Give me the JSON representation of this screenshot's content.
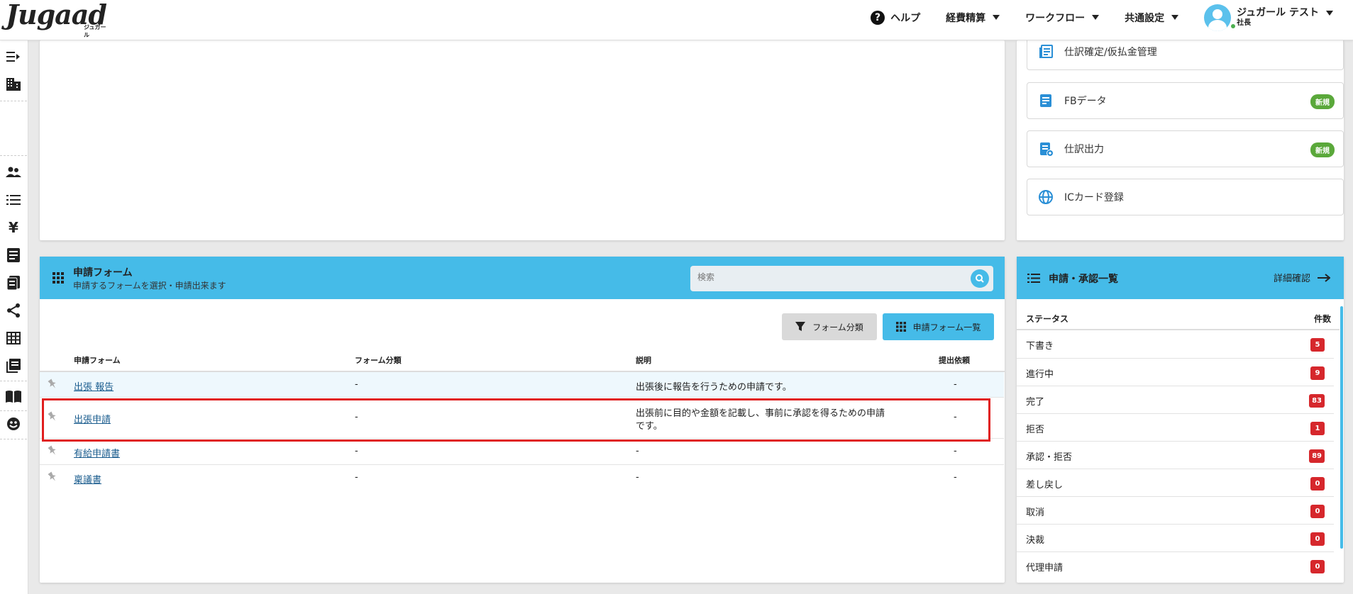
{
  "header": {
    "logo": "Jugaad",
    "logo_sub": "ジュガール",
    "nav": [
      {
        "label": "ヘルプ",
        "icon": "help-icon"
      },
      {
        "label": "経費精算"
      },
      {
        "label": "ワークフロー"
      },
      {
        "label": "共通設定"
      }
    ],
    "user": {
      "name": "ジュガール テスト",
      "role": "社長"
    }
  },
  "menu_cards": [
    {
      "label": "仕訳確定/仮払金管理",
      "icon": "journal-icon"
    },
    {
      "label": "FBデータ",
      "icon": "document-icon",
      "badge": "新規"
    },
    {
      "label": "仕訳出力",
      "icon": "export-icon",
      "badge": "新規"
    },
    {
      "label": "ICカード登録",
      "icon": "globe-icon"
    }
  ],
  "forms_panel": {
    "title": "申請フォーム",
    "subtitle": "申請するフォームを選択・申請出来ます",
    "search_placeholder": "検索",
    "btn_category": "フォーム分類",
    "btn_list": "申請フォーム一覧",
    "columns": [
      "申請フォーム",
      "フォーム分類",
      "説明",
      "提出依頼"
    ],
    "rows": [
      {
        "name": "出張 報告",
        "category": "-",
        "desc1": "出張後に報告を行うための申請です。",
        "desc2": "",
        "request": "-"
      },
      {
        "name": "出張申請",
        "category": "-",
        "desc1": "出張前に目的や金額を記載し、事前に承認を得るための申請",
        "desc2": "です。",
        "request": "-"
      },
      {
        "name": "有給申請書",
        "category": "-",
        "desc1": "-",
        "desc2": "",
        "request": "-"
      },
      {
        "name": "稟議書",
        "category": "-",
        "desc1": "-",
        "desc2": "",
        "request": "-"
      }
    ]
  },
  "approval_panel": {
    "title": "申請・承認一覧",
    "detail_link": "詳細確認",
    "col_status": "ステータス",
    "col_count": "件数",
    "statuses": [
      {
        "label": "下書き",
        "count": "5"
      },
      {
        "label": "進行中",
        "count": "9"
      },
      {
        "label": "完了",
        "count": "83"
      },
      {
        "label": "拒否",
        "count": "1"
      },
      {
        "label": "承認・拒否",
        "count": "89"
      },
      {
        "label": "差し戻し",
        "count": "0"
      },
      {
        "label": "取消",
        "count": "0"
      },
      {
        "label": "決裁",
        "count": "0"
      },
      {
        "label": "代理申請",
        "count": "0"
      }
    ]
  },
  "colors": {
    "accent": "#45bbe8",
    "badge_new": "#5aa83a",
    "count_badge": "#d6272c",
    "highlight": "#e01e1e"
  }
}
